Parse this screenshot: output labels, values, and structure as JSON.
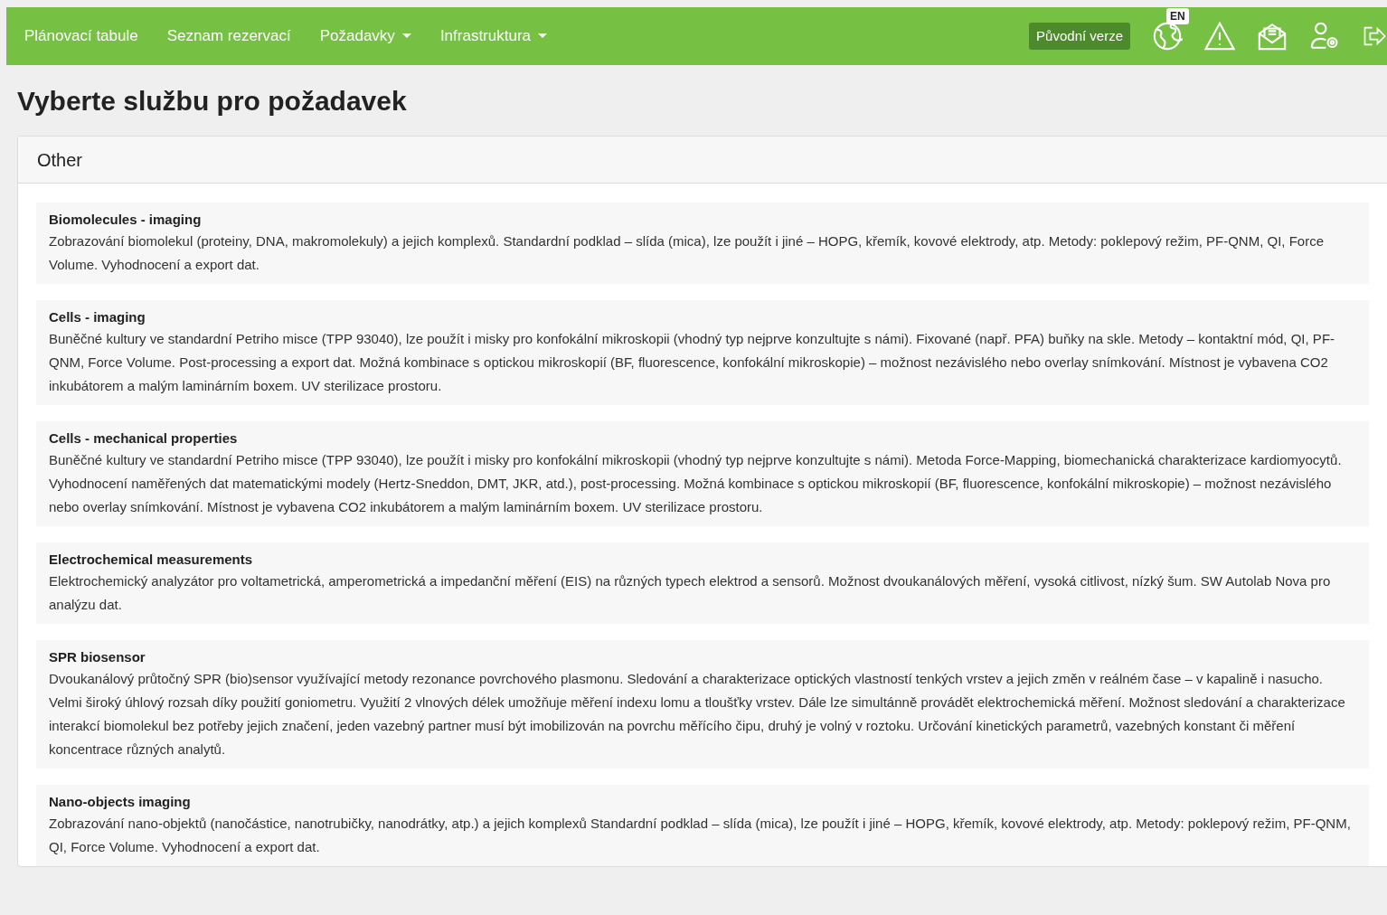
{
  "nav": {
    "items": [
      {
        "label": "Plánovací tabule",
        "kind": "link"
      },
      {
        "label": "Seznam rezervací",
        "kind": "link"
      },
      {
        "label": "Požadavky",
        "kind": "dropdown"
      },
      {
        "label": "Infrastruktura",
        "kind": "dropdown"
      }
    ],
    "version_button": "Původní verze",
    "language_badge": "EN"
  },
  "page_title": "Vyberte službu pro požadavek",
  "card": {
    "header": "Other",
    "services": [
      {
        "title": "Biomolecules - imaging",
        "description": "Zobrazování biomolekul (proteiny, DNA, makromolekuly) a jejich komplexů. Standardní podklad – slída (mica), lze použít i jiné – HOPG, křemík, kovové elektrody, atp. Metody: poklepový režim, PF-QNM, QI, Force Volume. Vyhodnocení a export dat."
      },
      {
        "title": "Cells - imaging",
        "description": "Buněčné kultury ve standardní Petriho misce (TPP 93040), lze použít i misky pro konfokální mikroskopii (vhodný typ nejprve konzultujte s námi). Fixované (např. PFA) buňky na skle. Metody – kontaktní mód, QI, PF-QNM, Force Volume. Post-processing a export dat. Možná kombinace s optickou mikroskopií (BF, fluorescence, konfokální mikroskopie) – možnost nezávislého nebo overlay snímkování. Místnost je vybavena CO2 inkubátorem a malým laminárním boxem. UV sterilizace prostoru."
      },
      {
        "title": "Cells - mechanical properties",
        "description": "Buněčné kultury ve standardní Petriho misce (TPP 93040), lze použít i misky pro konfokální mikroskopii (vhodný typ nejprve konzultujte s námi). Metoda Force-Mapping, biomechanická charakterizace kardiomyocytů. Vyhodnocení naměřených dat matematickými modely (Hertz-Sneddon, DMT, JKR, atd.), post-processing. Možná kombinace s optickou mikroskopií (BF, fluorescence, konfokální mikroskopie) – možnost nezávislého nebo overlay snímkování. Místnost je vybavena CO2 inkubátorem a malým laminárním boxem. UV sterilizace prostoru."
      },
      {
        "title": "Electrochemical measurements",
        "description": "Elektrochemický analyzátor pro voltametrická, amperometrická a impedanční měření (EIS) na různých typech elektrod a sensorů. Možnost dvoukanálových měření, vysoká citlivost, nízký šum. SW Autolab Nova pro analýzu dat."
      },
      {
        "title": "SPR biosensor",
        "description": "Dvoukanálový průtočný SPR (bio)sensor využívající metody rezonance povrchového plasmonu. Sledování a charakterizace optických vlastností tenkých vrstev a jejich změn v reálném čase – v kapalině i nasucho. Velmi široký úhlový rozsah díky použití goniometru. Využití 2 vlnových délek umožňuje měření indexu lomu a tloušťky vrstev. Dále lze simultánně provádět elektrochemická měření. Možnost sledování a charakterizace interakcí biomolekul bez potřeby jejich značení, jeden vazebný partner musí být imobilizován na povrchu měřícího čipu, druhý je volný v roztoku. Určování kinetických parametrů, vazebných konstant či měření koncentrace různých analytů."
      },
      {
        "title": "Nano-objects imaging",
        "description": "Zobrazování nano-objektů (nanočástice, nanotrubičky, nanodrátky, atp.) a jejich komplexů Standardní podklad – slída (mica), lze použít i jiné – HOPG, křemík, kovové elektrody, atp. Metody: poklepový režim, PF-QNM, QI, Force Volume. Vyhodnocení a export dat."
      }
    ]
  }
}
